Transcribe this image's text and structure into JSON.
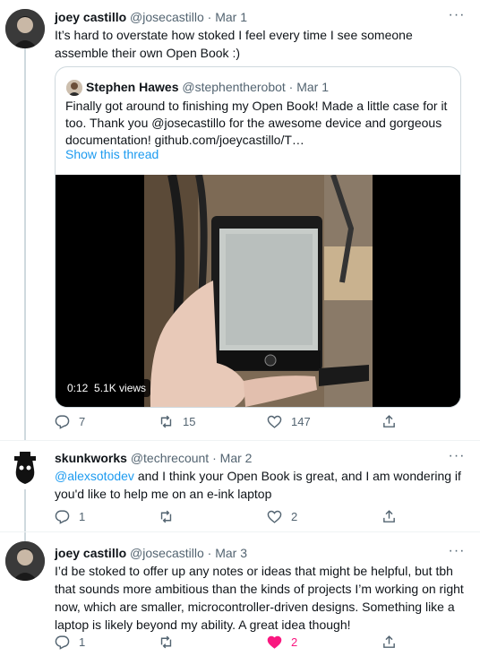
{
  "tweets": [
    {
      "name": "joey castillo",
      "handle": "@josecastillo",
      "sep": " · ",
      "date": "Mar 1",
      "text": "It’s hard to overstate how stoked I feel every time I see someone assemble their own Open Book :)",
      "quote": {
        "name": "Stephen Hawes",
        "handle": "@stephentherobot",
        "date": "Mar 1",
        "text": "Finally got around to finishing my Open Book! Made a little case for it too. Thank you @josecastillo for the awesome device and gorgeous documentation! github.com/joeycastillo/T…",
        "show_thread": "Show this thread",
        "video_time": "0:12",
        "video_views": "5.1K views"
      },
      "replies": "7",
      "retweets": "15",
      "likes": "147"
    },
    {
      "name": "skunkworks",
      "handle": "@techrecount",
      "sep": " · ",
      "date": "Mar 2",
      "mention": "@alexsotodev",
      "text": " and I think your Open Book is great, and I am wondering if you'd like to help me on an e-ink laptop",
      "replies": "1",
      "retweets": "",
      "likes": "2"
    },
    {
      "name": "joey castillo",
      "handle": "@josecastillo",
      "sep": " · ",
      "date": "Mar 3",
      "text": "I’d be stoked to offer up any notes or ideas that might be helpful, but tbh that sounds more ambitious than the kinds of projects I’m working on right now, which are smaller, microcontroller-driven designs. Something like a laptop is likely beyond my ability. A great idea though!",
      "replies": "1",
      "retweets": "",
      "likes": "2",
      "liked": true
    }
  ],
  "more_label": "···",
  "colors": {
    "link": "#1d9bf0",
    "muted": "#536471",
    "like_active": "#f91880"
  },
  "icons": [
    "more-icon",
    "reply-icon",
    "retweet-icon",
    "like-icon",
    "share-icon"
  ]
}
